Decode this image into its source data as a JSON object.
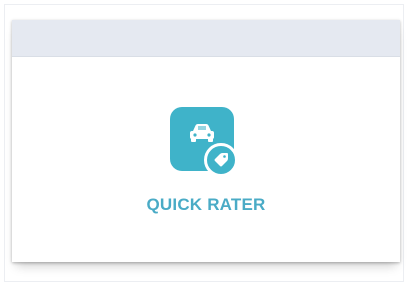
{
  "tile": {
    "label": "QUICK RATER",
    "icon": "car-with-tag-icon",
    "accent_color": "#3fb3c9",
    "label_color": "#4aabc6"
  },
  "card": {
    "header_color": "#e5e9f1"
  }
}
